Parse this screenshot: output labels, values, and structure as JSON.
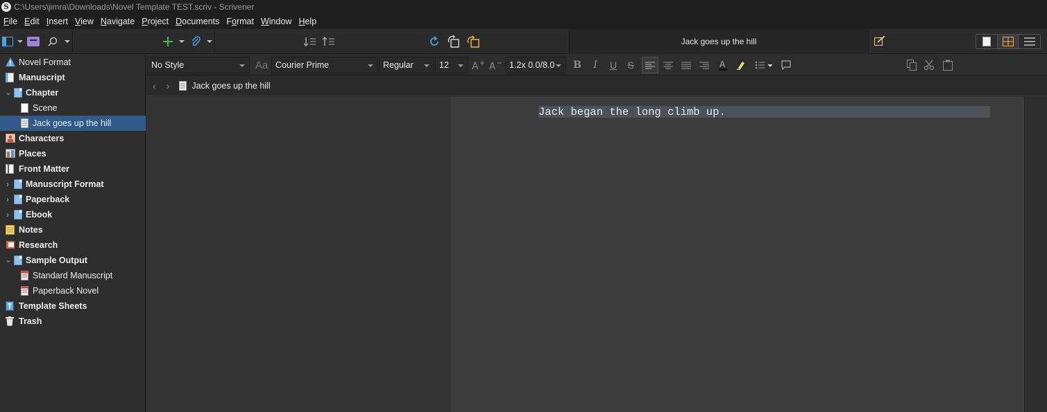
{
  "window": {
    "title": "C:\\Users\\jimra\\Downloads\\Novel Template TEST.scriv - Scrivener"
  },
  "menu": [
    {
      "label": "File",
      "key": "F"
    },
    {
      "label": "Edit",
      "key": "E"
    },
    {
      "label": "Insert",
      "key": "I"
    },
    {
      "label": "View",
      "key": "V"
    },
    {
      "label": "Navigate",
      "key": "N"
    },
    {
      "label": "Project",
      "key": "P"
    },
    {
      "label": "Documents",
      "key": "D"
    },
    {
      "label": "Format",
      "key": "o"
    },
    {
      "label": "Window",
      "key": "W"
    },
    {
      "label": "Help",
      "key": "H"
    }
  ],
  "toolbar": {
    "document_title": "Jack goes up the hill"
  },
  "binder": {
    "items": [
      {
        "label": "Novel Format",
        "bold": false,
        "icon": "warning-icon"
      },
      {
        "label": "Manuscript",
        "bold": true,
        "icon": "manuscript-icon"
      },
      {
        "label": "Chapter",
        "bold": true,
        "icon": "folder-doc-icon"
      },
      {
        "label": "Scene",
        "bold": false,
        "icon": "blank-doc-icon"
      },
      {
        "label": "Jack goes up the hill",
        "bold": false,
        "icon": "text-doc-icon",
        "selected": true
      },
      {
        "label": "Characters",
        "bold": true,
        "icon": "characters-icon"
      },
      {
        "label": "Places",
        "bold": true,
        "icon": "places-icon"
      },
      {
        "label": "Front Matter",
        "bold": true,
        "icon": "front-matter-icon"
      },
      {
        "label": "Manuscript Format",
        "bold": true,
        "icon": "folder-doc-icon"
      },
      {
        "label": "Paperback",
        "bold": true,
        "icon": "folder-doc-icon"
      },
      {
        "label": "Ebook",
        "bold": true,
        "icon": "folder-doc-icon"
      },
      {
        "label": "Notes",
        "bold": true,
        "icon": "notes-icon"
      },
      {
        "label": "Research",
        "bold": true,
        "icon": "research-icon"
      },
      {
        "label": "Sample Output",
        "bold": true,
        "icon": "folder-doc-icon"
      },
      {
        "label": "Standard Manuscript",
        "bold": false,
        "icon": "pdf-icon"
      },
      {
        "label": "Paperback Novel",
        "bold": false,
        "icon": "pdf-icon"
      },
      {
        "label": "Template Sheets",
        "bold": true,
        "icon": "template-icon"
      },
      {
        "label": "Trash",
        "bold": true,
        "icon": "trash-icon"
      }
    ]
  },
  "format": {
    "style": "No Style",
    "font": "Courier Prime",
    "weight": "Regular",
    "size": "12",
    "spacing": "1.2x 0.0/8.0"
  },
  "header": {
    "doc_title": "Jack goes up the hill"
  },
  "editor": {
    "text": "Jack began the long climb up."
  },
  "colors": {
    "accent": "#2f5a8a",
    "add": "#3fbf5a",
    "sync": "#3fa8e0",
    "notes": "#f0c040"
  }
}
